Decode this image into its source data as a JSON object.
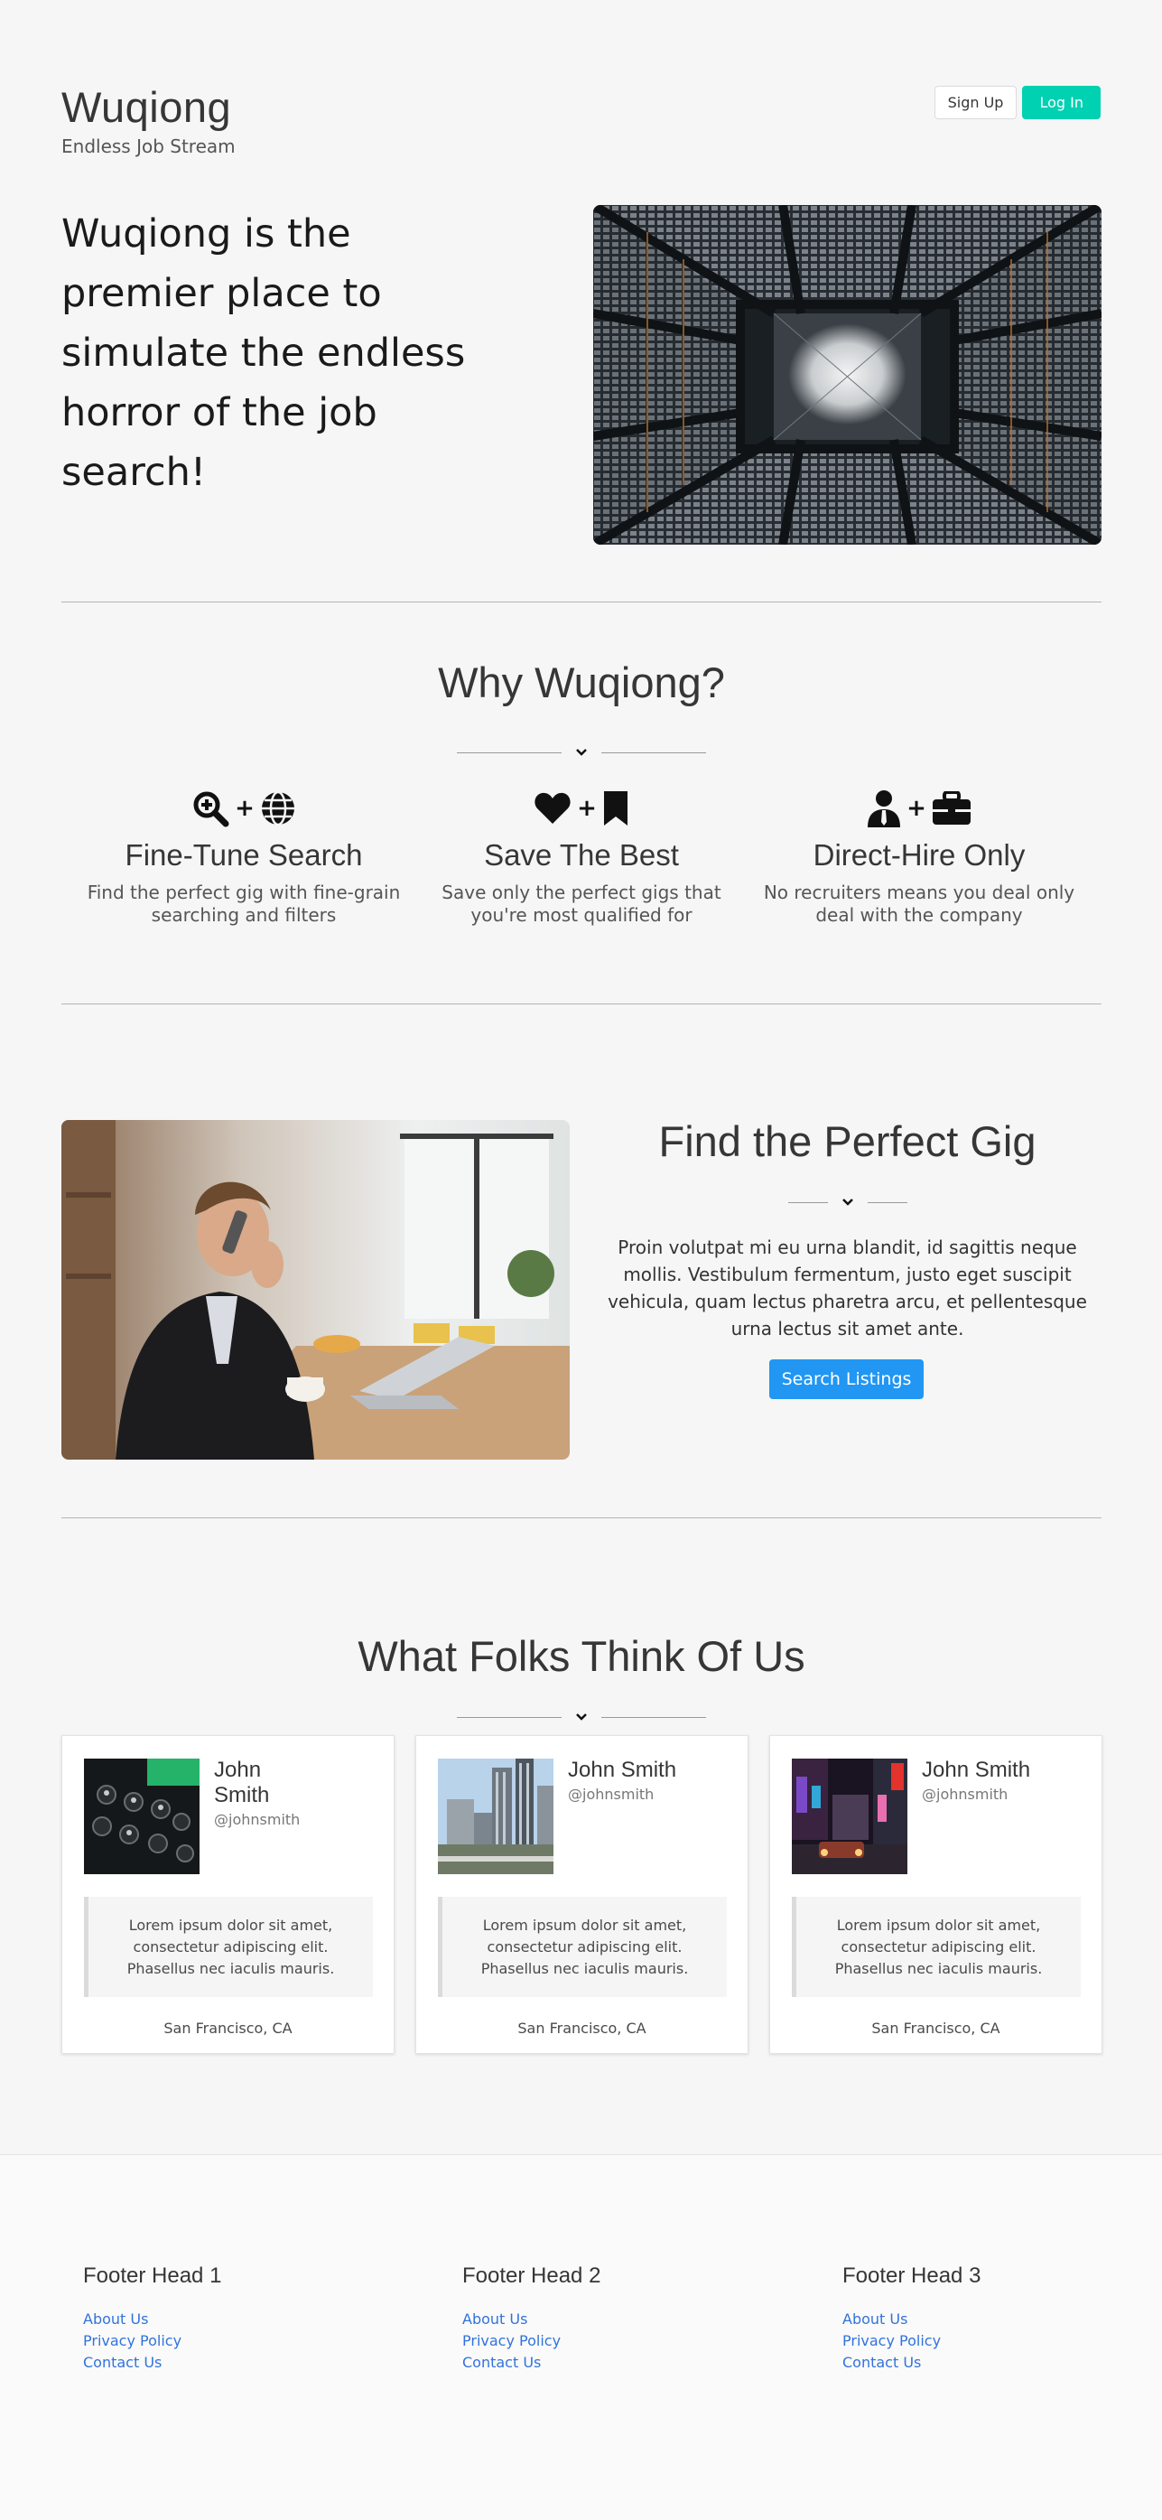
{
  "header": {
    "brand_title": "Wuqiong",
    "brand_subtitle": "Endless Job Stream",
    "signup_label": "Sign Up",
    "login_label": "Log In"
  },
  "hero": {
    "headline": "Wuqiong is the premier place to simulate the endless horror of the job search!"
  },
  "why": {
    "title": "Why Wuqiong?",
    "features": [
      {
        "title": "Fine-Tune Search",
        "text": "Find the perfect gig with fine-grain searching and filters",
        "icons": [
          "search-plus-icon",
          "globe-icon"
        ]
      },
      {
        "title": "Save The Best",
        "text": "Save only the perfect gigs that you're most qualified for",
        "icons": [
          "heart-icon",
          "bookmark-icon"
        ]
      },
      {
        "title": "Direct-Hire Only",
        "text": "No recruiters means you deal only deal with the company",
        "icons": [
          "user-tie-icon",
          "briefcase-icon"
        ]
      }
    ],
    "plus": "+"
  },
  "gig": {
    "title": "Find the Perfect Gig",
    "text": "Proin volutpat mi eu urna blandit, id sagittis neque mollis. Vestibulum fermentum, justo eget suscipit vehicula, quam lectus pharetra arcu, et pellentesque urna lectus sit amet ante.",
    "button_label": "Search Listings"
  },
  "testimonials": {
    "title": "What Folks Think Of Us",
    "cards": [
      {
        "name": "John Smith",
        "handle": "@johnsmith",
        "quote": "Lorem ipsum dolor sit amet, consectetur adipiscing elit. Phasellus nec iaculis mauris.",
        "location": "San Francisco, CA"
      },
      {
        "name": "John Smith",
        "handle": "@johnsmith",
        "quote": "Lorem ipsum dolor sit amet, consectetur adipiscing elit. Phasellus nec iaculis mauris.",
        "location": "San Francisco, CA"
      },
      {
        "name": "John Smith",
        "handle": "@johnsmith",
        "quote": "Lorem ipsum dolor sit amet, consectetur adipiscing elit. Phasellus nec iaculis mauris.",
        "location": "San Francisco, CA"
      }
    ]
  },
  "footer": {
    "columns": [
      {
        "heading": "Footer Head 1",
        "links": [
          "About Us",
          "Privacy Policy",
          "Contact Us"
        ]
      },
      {
        "heading": "Footer Head 2",
        "links": [
          "About Us",
          "Privacy Policy",
          "Contact Us"
        ]
      },
      {
        "heading": "Footer Head 3",
        "links": [
          "About Us",
          "Privacy Policy",
          "Contact Us"
        ]
      }
    ]
  },
  "colors": {
    "accent_teal": "#00d1b2",
    "button_blue": "#2196f3",
    "link_blue": "#3273dc",
    "text_dark": "#363636"
  }
}
